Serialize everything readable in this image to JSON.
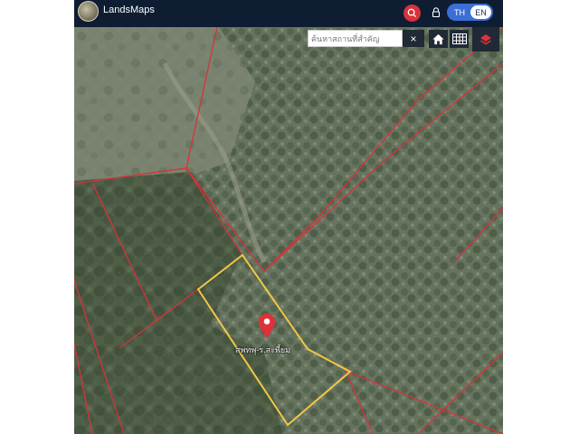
{
  "header": {
    "app_title": "LandsMaps",
    "lang_th": "TH",
    "lang_en": "EN",
    "active_lang": "EN"
  },
  "toolbar": {
    "search_placeholder": "ค้นหาสถานที่สำคัญ",
    "clear_label": "×"
  },
  "map": {
    "parcel_label": "สพทพุ-ร.สะพี้ยม",
    "colors": {
      "boundary": "#d8323a",
      "selected_parcel": "#f2c744",
      "pin": "#e0303a",
      "topbar": "#0f1d33"
    }
  },
  "icons": [
    "logo-icon",
    "search-icon",
    "lock-icon",
    "close-icon",
    "home-icon",
    "grid-icon",
    "layers-icon",
    "location-pin-icon"
  ]
}
